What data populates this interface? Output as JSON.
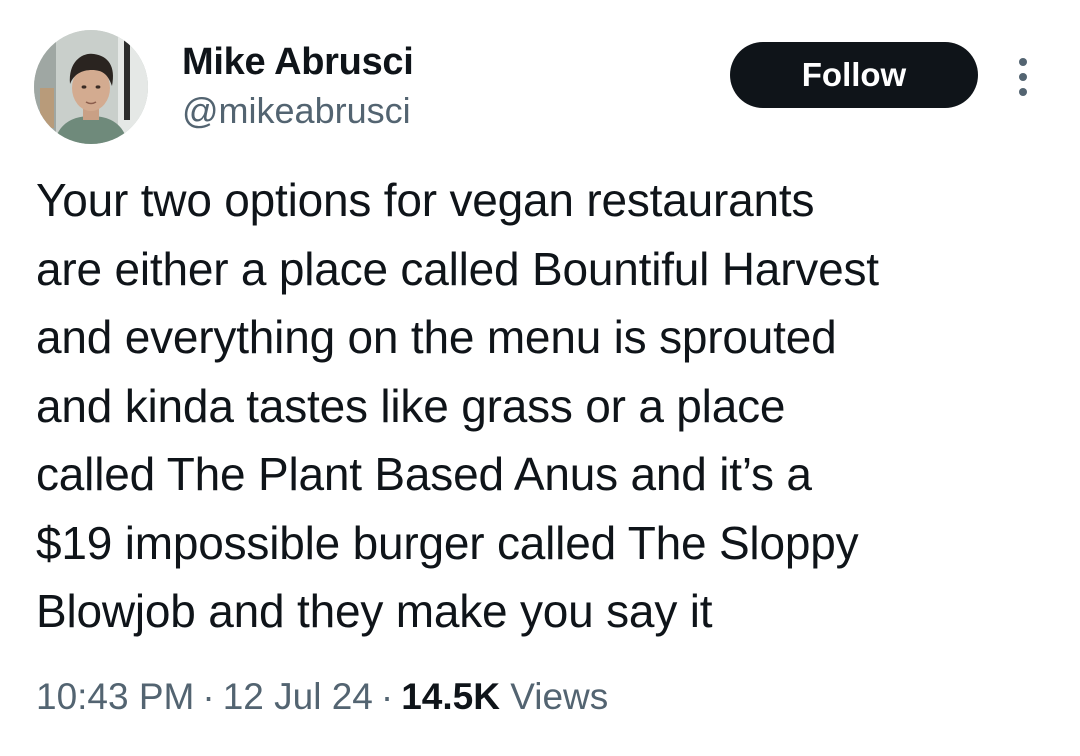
{
  "author": {
    "name": "Mike Abrusci",
    "handle": "@mikeabrusci"
  },
  "actions": {
    "follow_label": "Follow",
    "more_icon": "more-vertical-icon"
  },
  "tweet": {
    "text": "Your two options for vegan restaurants\nare either a place called Bountiful Harvest\nand everything on the menu is sprouted\nand kinda tastes like grass or a place\ncalled The Plant Based Anus and it’s a\n$19 impossible burger called The Sloppy\nBlowjob and they make you say it",
    "time": "10:43 PM",
    "date": "12 Jul 24",
    "separator": "·",
    "views_count": "14.5K",
    "views_label": "Views"
  },
  "colors": {
    "text_primary": "#0f1419",
    "text_secondary": "#536471",
    "follow_bg": "#0f1419",
    "follow_text": "#ffffff",
    "background": "#ffffff"
  }
}
